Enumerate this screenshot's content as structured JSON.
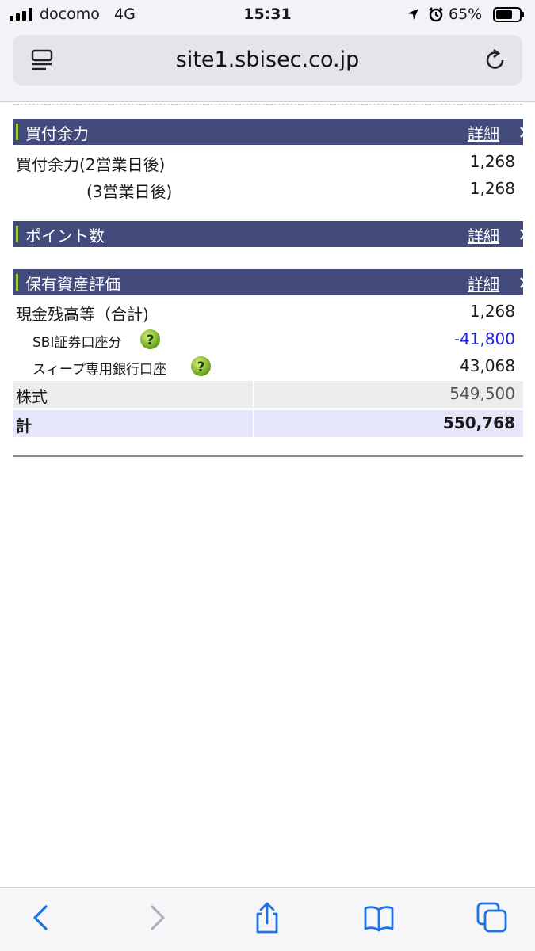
{
  "status_bar": {
    "carrier": "docomo",
    "network": "4G",
    "time": "15:31",
    "battery": "65%",
    "icons": [
      "signal-icon",
      "location-icon",
      "alarm-icon",
      "battery-icon"
    ]
  },
  "browser": {
    "url": "site1.sbisec.co.jp",
    "icons": [
      "reader-icon",
      "reload-icon"
    ]
  },
  "sections": {
    "buying_power": {
      "title": "買付余力",
      "detail": "詳細",
      "rows": [
        {
          "label": "買付余力(2営業日後)",
          "value": "1,268"
        },
        {
          "label": "(3営業日後)",
          "value": "1,268"
        }
      ]
    },
    "points": {
      "title": "ポイント数",
      "detail": "詳細"
    },
    "holdings": {
      "title": "保有資産評価",
      "detail": "詳細",
      "rows": [
        {
          "label": "現金残高等（合計)",
          "value": "1,268"
        },
        {
          "label": "SBI証券口座分",
          "value": "-41,800"
        },
        {
          "label": "スィープ専用銀行口座",
          "value": "43,068"
        },
        {
          "label": "株式",
          "value": "549,500"
        },
        {
          "label": "計",
          "value": "550,768"
        }
      ]
    }
  },
  "colors": {
    "header_bg": "#424b7c",
    "accent_bar": "#9ecf3a",
    "negative": "#1e22d6",
    "total_bg": "#e6e6fa",
    "ios_blue": "#1a73e8"
  },
  "toolbar": {
    "icons": [
      "back-icon",
      "forward-icon",
      "share-icon",
      "bookmarks-icon",
      "tabs-icon"
    ]
  }
}
